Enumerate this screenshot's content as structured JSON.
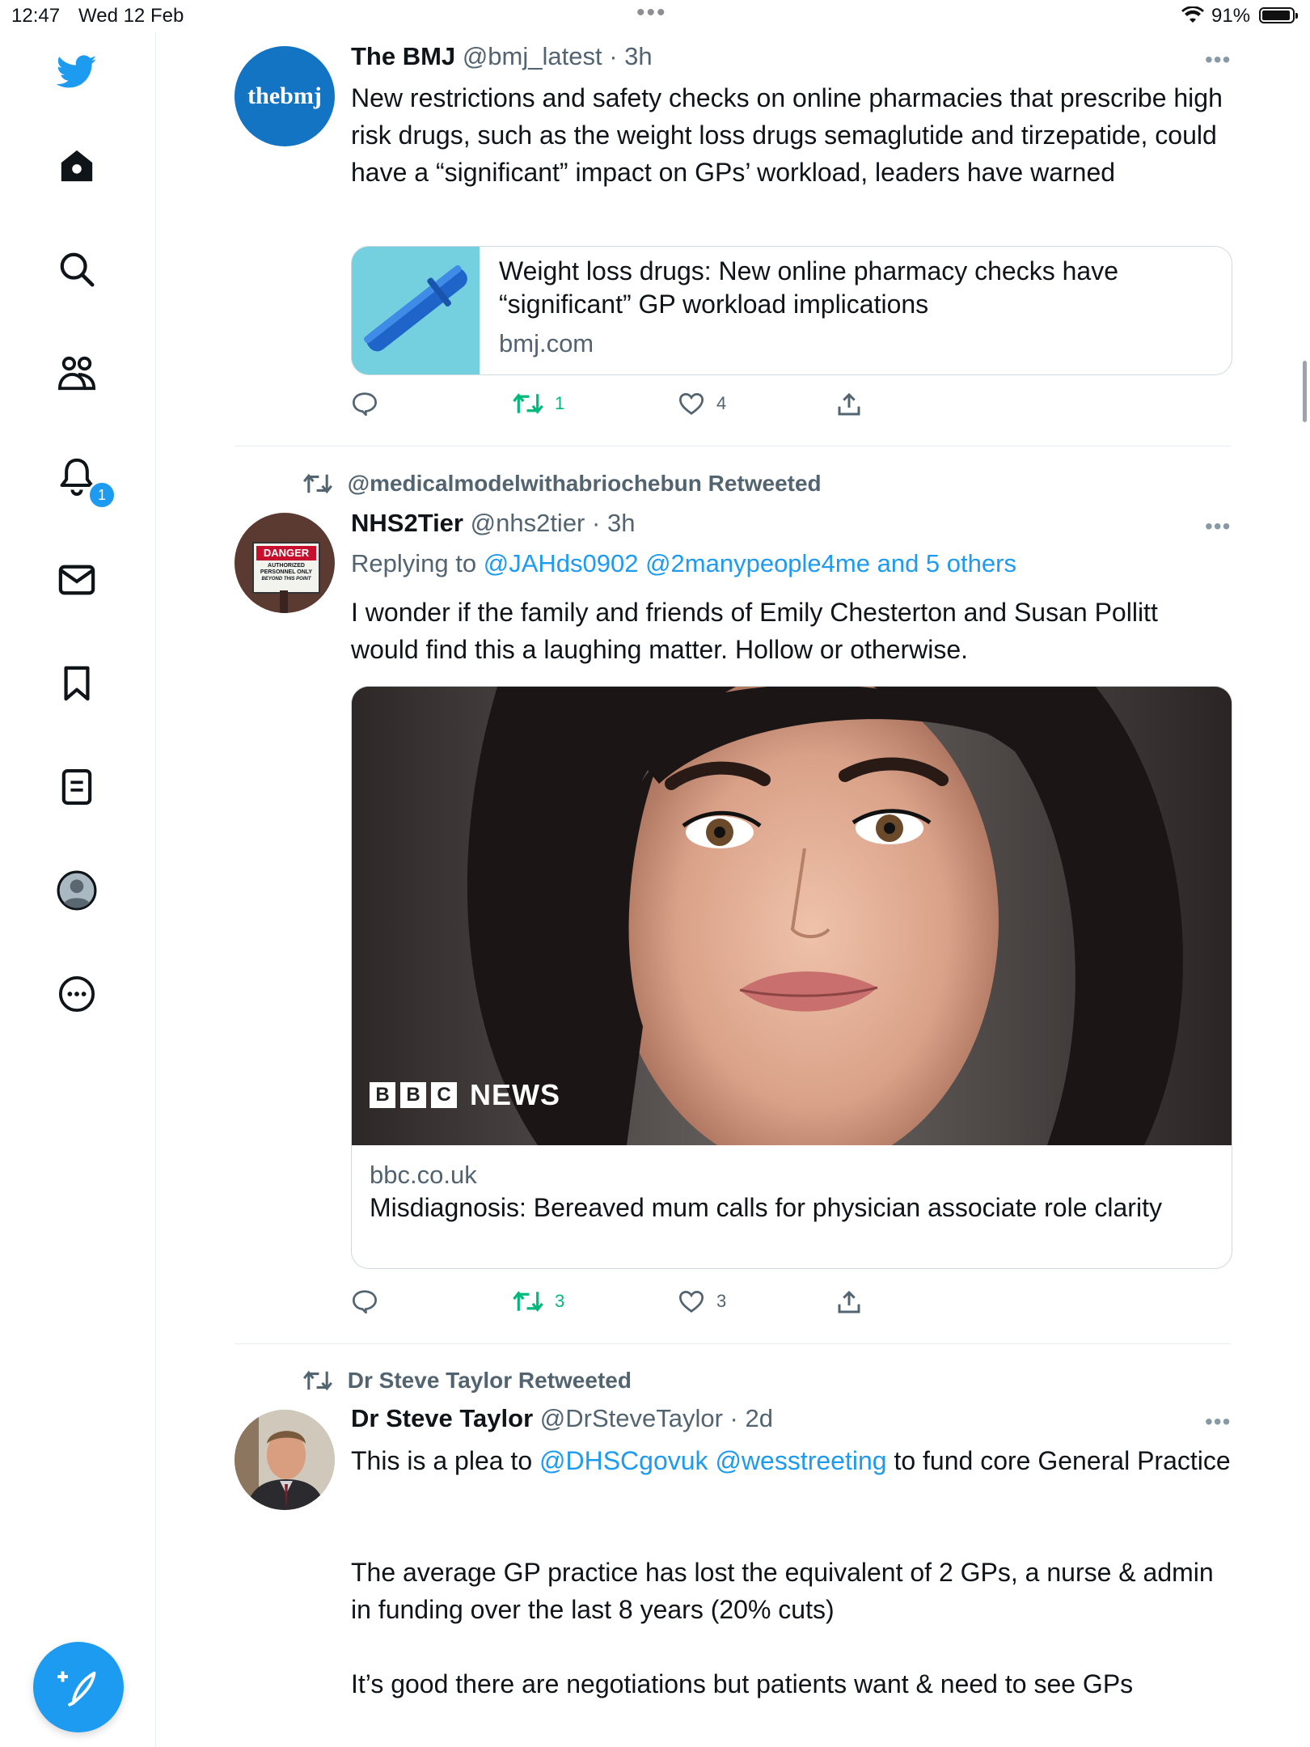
{
  "status_bar": {
    "time": "12:47",
    "date": "Wed 12 Feb",
    "battery": "91%"
  },
  "sidebar": {
    "items": [
      {
        "icon": "twitter-bird-icon"
      },
      {
        "icon": "home-icon"
      },
      {
        "icon": "search-icon"
      },
      {
        "icon": "communities-icon"
      },
      {
        "icon": "notifications-icon",
        "badge": "1"
      },
      {
        "icon": "messages-icon"
      },
      {
        "icon": "bookmarks-icon"
      },
      {
        "icon": "lists-icon"
      },
      {
        "icon": "profile-icon"
      },
      {
        "icon": "more-icon"
      }
    ],
    "accent_color": "#1d9bf0"
  },
  "tweets": [
    {
      "name": "The BMJ",
      "handle": "@bmj_latest",
      "time": "· 3h",
      "avatar_text": "thebmj",
      "text": "New restrictions and safety checks on online pharmacies that prescribe high risk drugs, such as the weight loss drugs semaglutide and tirzepatide, could have a “significant” impact on GPs’ workload, leaders have warned",
      "card": {
        "title": "Weight loss drugs: New online pharmacy checks have “significant” GP workload implications",
        "domain": "bmj.com"
      },
      "retweets": "1",
      "likes": "4"
    },
    {
      "retweeted_by": "@medicalmodelwithabriochebun Retweeted",
      "name": "NHS2Tier",
      "handle": "@nhs2tier",
      "time": "· 3h",
      "replying_prefix": "Replying to ",
      "replying_to": "@JAHds0902 @2manypeople4me and 5 others",
      "avatar_sign": {
        "line1": "DANGER",
        "line2": "AUTHORIZED",
        "line3": "PERSONNEL ONLY",
        "line4": "BEYOND THIS POINT"
      },
      "text": "I wonder if the family and friends of Emily Chesterton and Susan Pollitt would find this a laughing matter. Hollow or otherwise.",
      "card": {
        "brand_letters": [
          "B",
          "B",
          "C"
        ],
        "brand_word": "NEWS",
        "domain": "bbc.co.uk",
        "title": "Misdiagnosis: Bereaved mum calls for physician associate role clarity"
      },
      "retweets": "3",
      "likes": "3"
    },
    {
      "retweeted_by": "Dr Steve Taylor Retweeted",
      "name": "Dr Steve Taylor",
      "handle": "@DrSteveTaylor",
      "time": "· 2d",
      "text_prefix": "This is a plea to ",
      "mention1": "@DHSCgovuk",
      "mention2": "@wesstreeting",
      "text_suffix": " to fund core General Practice",
      "paragraph2": "The average GP practice has lost the equivalent of 2 GPs, a nurse & admin in funding over the last 8 years (20% cuts)",
      "paragraph3": "It’s good there are negotiations but patients want & need to see GPs"
    }
  ]
}
